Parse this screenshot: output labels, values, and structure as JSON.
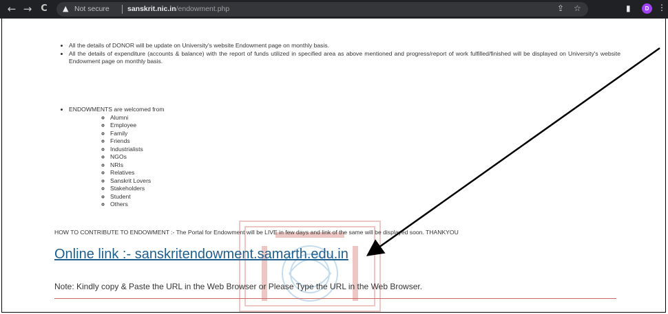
{
  "browser": {
    "back_icon": "←",
    "forward_icon": "→",
    "reload_icon": "C",
    "warning_icon": "▲",
    "security_label": "Not secure",
    "url_domain": "sanskrit.nic.in",
    "url_path": "/endowment.php",
    "share_icon": "⇪",
    "star_icon": "☆",
    "panel_icon": "▮",
    "avatar_letter": "D",
    "menu_icon": "⋮"
  },
  "page": {
    "notes": [
      "All the details of DONOR will be update on University's website Endowment page on monthly basis.",
      "All the details of expenditure (accounts & balance) with the report of funds utilized in specified area as above mentioned and progress/report of work fulfilled/finished will be displayed on University's website Endowment page on monthly basis."
    ],
    "welcome_heading": "ENDOWMENTS are welcomed from",
    "welcome_list": [
      "Alumni",
      "Employee",
      "Family",
      "Friends",
      "Industrialists",
      "NGOs",
      "NRIs",
      "Relatives",
      "Sanskrit Lovers",
      "Stakeholders",
      "Student",
      "Others"
    ],
    "how_to": "HOW TO CONTRIBUTE TO ENDOWMENT :- The Portal for Endowment will be LIVE in few days and link of the same will be displayed soon. THANKYOU",
    "online_link": "Online link :- sanskritendowment.samarth.edu.in",
    "note": "Note: Kindly copy & Paste the URL in the Web Browser or Please Type the URL in the Web Browser."
  },
  "colors": {
    "chrome": "#202124",
    "link": "#1f5f8c",
    "rule": "#cc6666",
    "avatar": "#a142f4"
  }
}
